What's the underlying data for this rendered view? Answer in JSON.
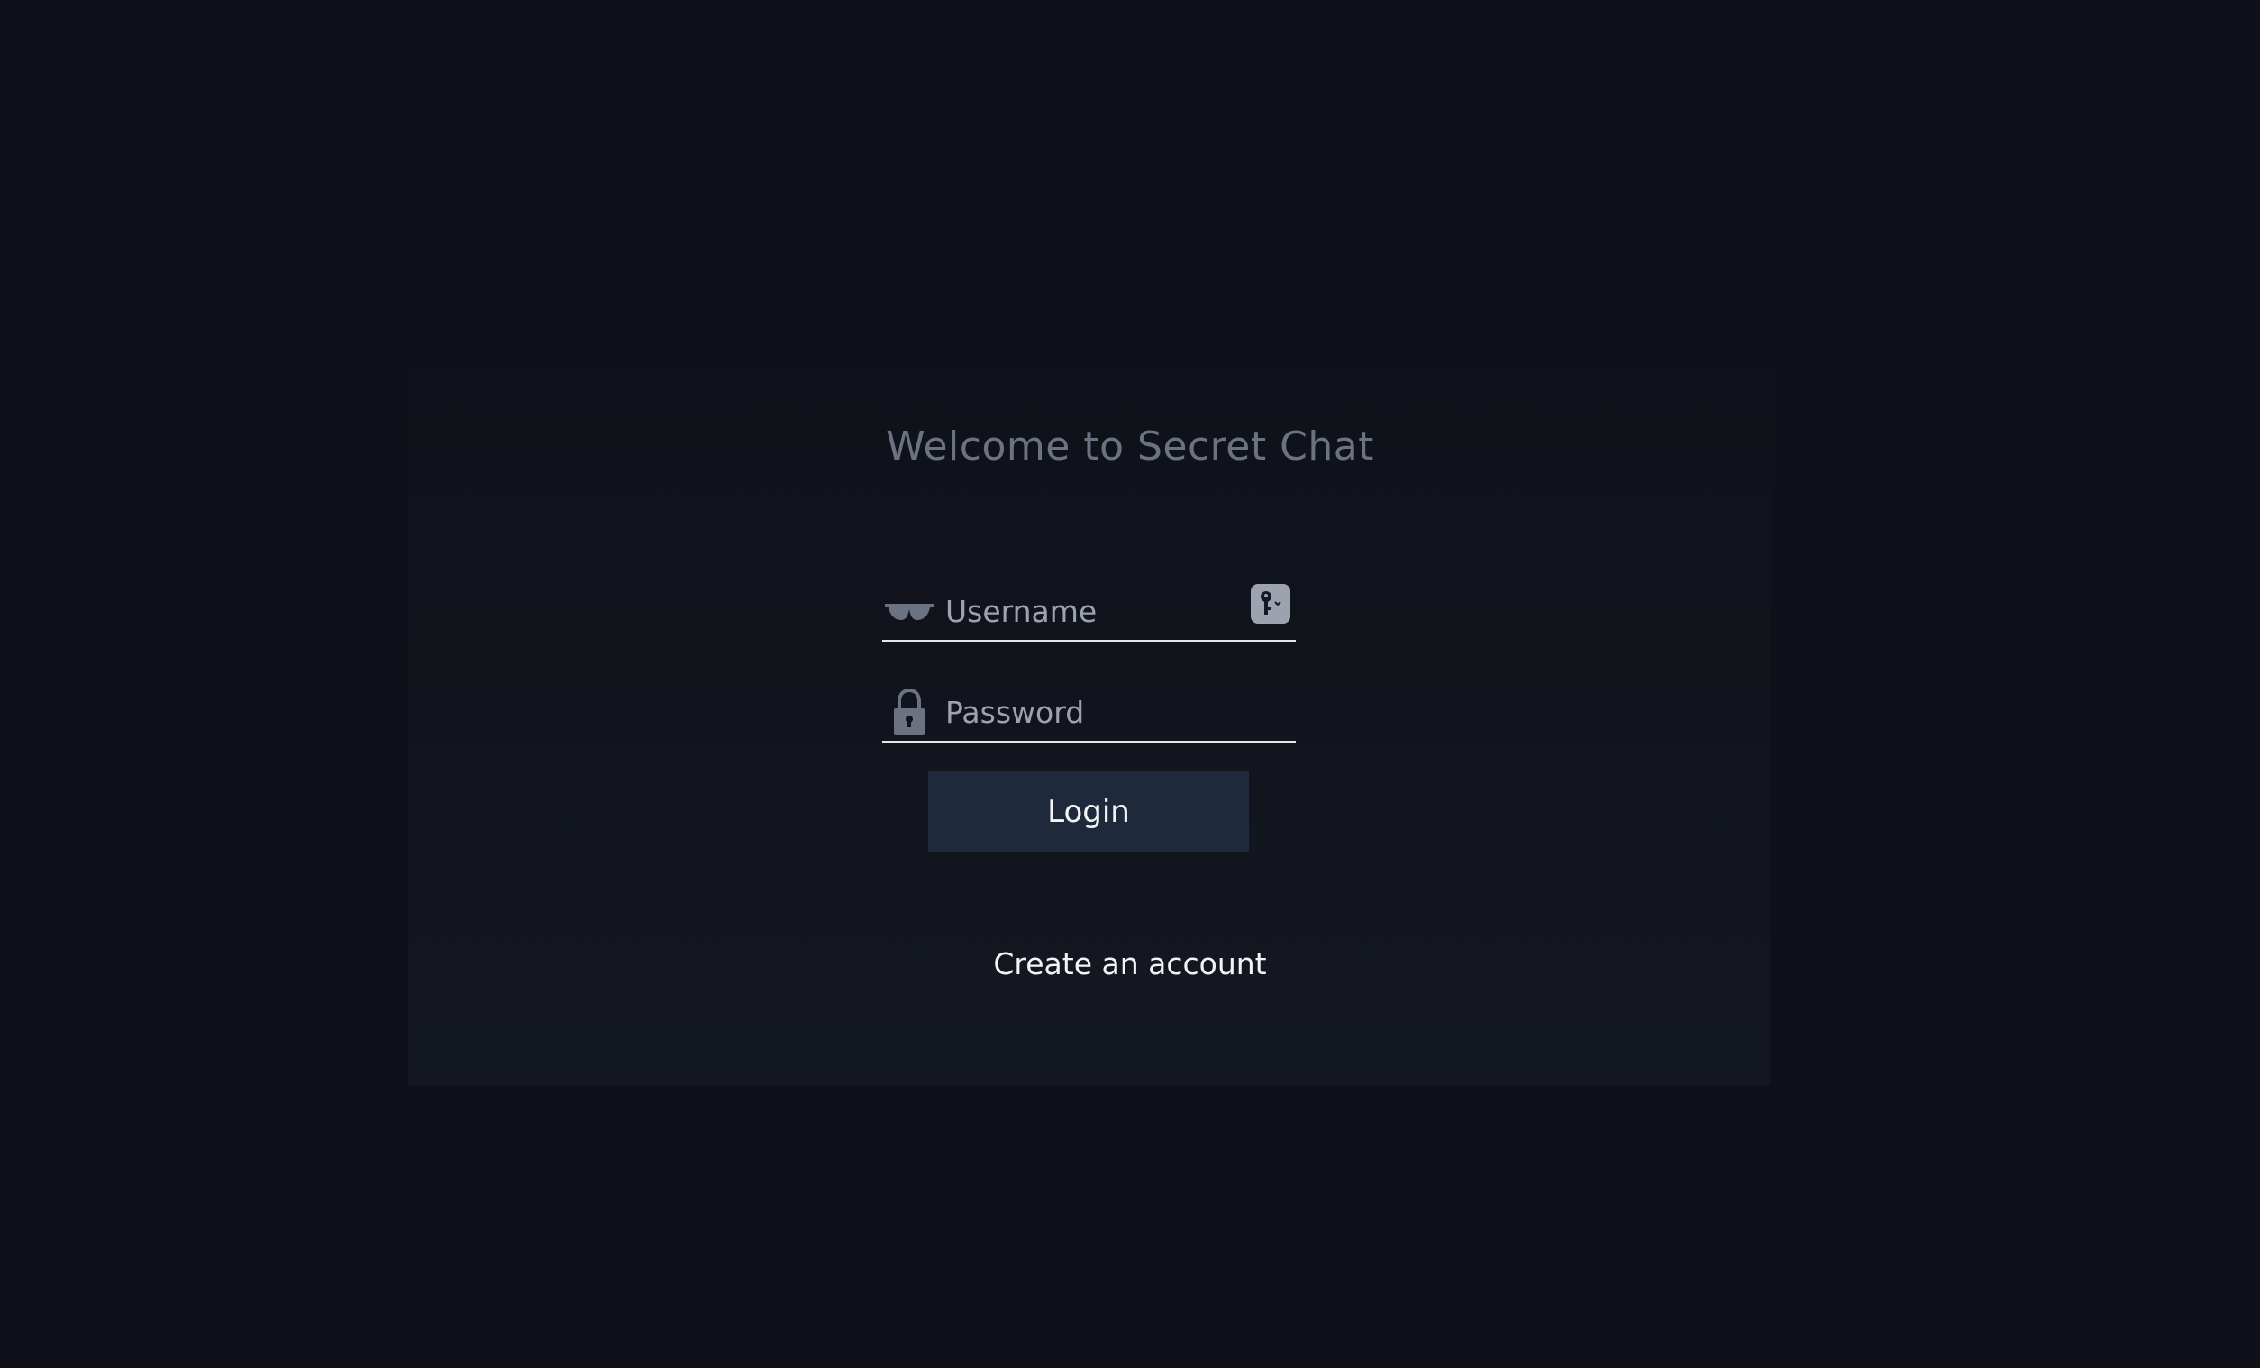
{
  "title": "Welcome to Secret Chat",
  "form": {
    "username": {
      "placeholder": "Username",
      "value": "",
      "icon": "sunglasses-icon"
    },
    "password": {
      "placeholder": "Password",
      "value": "",
      "icon": "lock-icon"
    },
    "password_manager_icon": "key-icon",
    "login_label": "Login",
    "create_account_label": "Create an account"
  },
  "colors": {
    "background": "#0f1019",
    "card": "#12141c",
    "title": "#6b7280",
    "button": "#1e293b",
    "text": "#f3f4f6"
  }
}
